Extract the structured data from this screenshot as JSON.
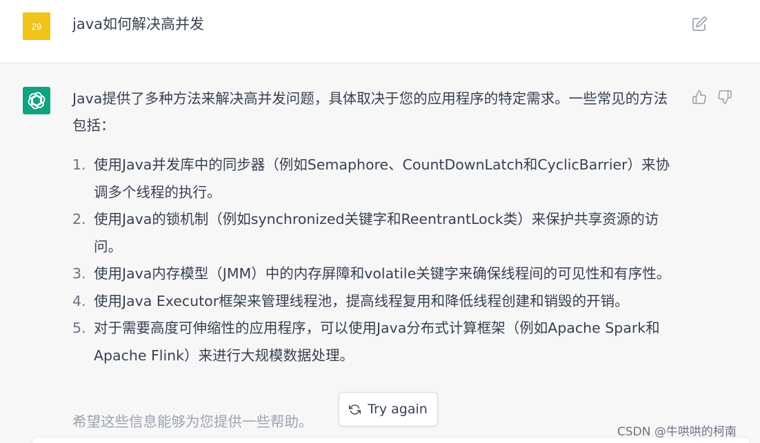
{
  "user_message": {
    "avatar_text": "29",
    "avatar_color": "#f0c419",
    "text": "java如何解决高并发",
    "edit_icon": "edit-icon"
  },
  "assistant_message": {
    "avatar_icon": "openai-logo-icon",
    "avatar_color": "#10a37f",
    "intro": "Java提供了多种方法来解决高并发问题，具体取决于您的应用程序的特定需求。一些常见的方法包括：",
    "items": [
      {
        "num": "1.",
        "text": "使用Java并发库中的同步器（例如Semaphore、CountDownLatch和CyclicBarrier）来协调多个线程的执行。"
      },
      {
        "num": "2.",
        "text": "使用Java的锁机制（例如synchronized关键字和ReentrantLock类）来保护共享资源的访问。"
      },
      {
        "num": "3.",
        "text": "使用Java内存模型（JMM）中的内存屏障和volatile关键字来确保线程间的可见性和有序性。"
      },
      {
        "num": "4.",
        "text": "使用Java Executor框架来管理线程池，提高线程复用和降低线程创建和销毁的开销。"
      },
      {
        "num": "5.",
        "text": "对于需要高度可伸缩性的应用程序，可以使用Java分布式计算框架（例如Apache Spark和Apache Flink）来进行大规模数据处理。"
      }
    ],
    "closing": "希望这些信息能够为您提供一些帮助。",
    "thumb_up_icon": "thumbs-up-icon",
    "thumb_down_icon": "thumbs-down-icon"
  },
  "try_again": {
    "label": "Try again",
    "icon": "refresh-icon"
  },
  "watermark": "CSDN @牛哄哄的柯南"
}
